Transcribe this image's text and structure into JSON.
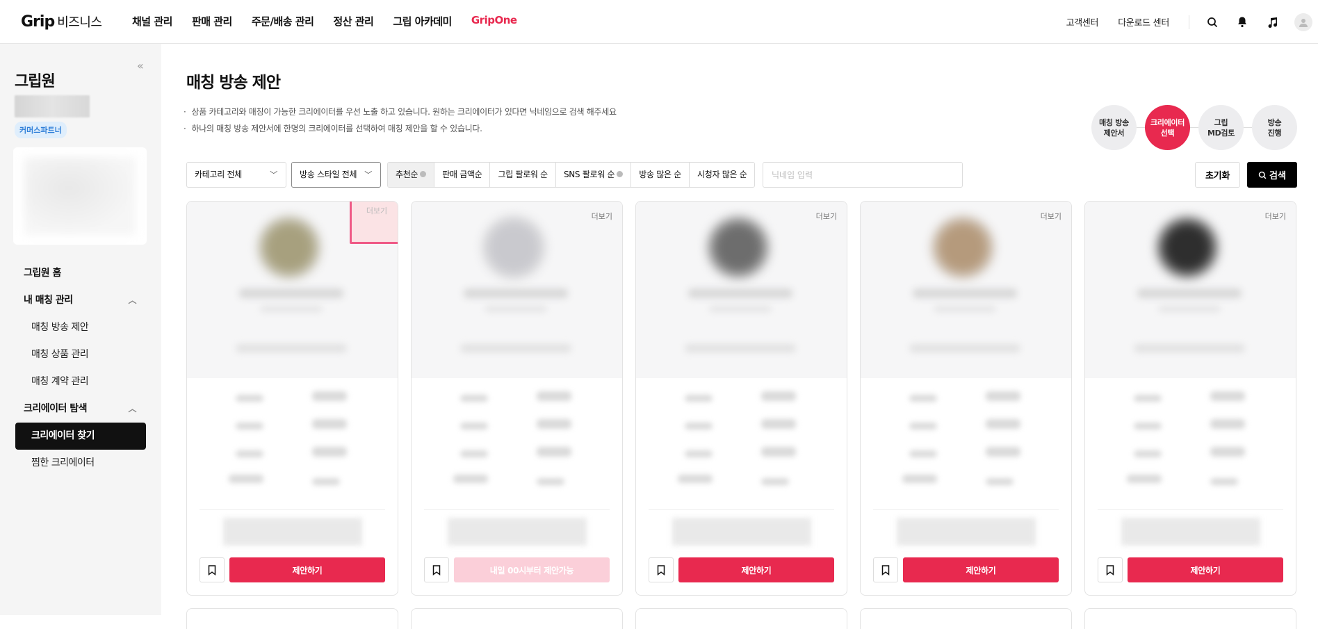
{
  "header": {
    "logo_main": "Grip",
    "logo_sub": "비즈니스",
    "nav": [
      "채널 관리",
      "판매 관리",
      "주문/배송 관리",
      "정산 관리",
      "그립 아카데미",
      "GripOne"
    ],
    "right_links": [
      "고객센터",
      "다운로드 센터"
    ]
  },
  "sidebar": {
    "collapse_label": "«",
    "title": "그립원",
    "badge": "커머스파트너",
    "home": "그립원 홈",
    "group1": "내 매칭 관리",
    "group1_items": [
      "매칭 방송 제안",
      "매칭 상품 관리",
      "매칭 계약 관리"
    ],
    "group2": "크리에이터 탐색",
    "group2_items": [
      "크리에이터 찾기",
      "찜한 크리에이터"
    ]
  },
  "main": {
    "title": "매칭 방송 제안",
    "notes": [
      "상품 카테고리와 매칭이 가능한 크리에이터를 우선 노출 하고 있습니다. 원하는 크리에이터가 있다면 닉네임으로 검색 해주세요",
      "하나의 매칭 방송 제안서에 한명의 크리에이터를 선택하여 매칭 제안을 할 수 있습니다."
    ],
    "steps": [
      "매칭 방송\n제안서",
      "크리에이터\n선택",
      "그립\nMD검토",
      "방송\n진행"
    ],
    "active_step": 1,
    "filters": {
      "category": "카테고리 전체",
      "style": "방송 스타일 전체",
      "sorts": [
        "추천순",
        "판매 금액순",
        "그립 팔로워 순",
        "SNS 팔로워 순",
        "방송 많은 순",
        "시청자 많은 순"
      ],
      "selected_sort": "추천순",
      "search_placeholder": "닉네임 입력",
      "reset": "초기화",
      "search": "검색"
    },
    "cards": [
      {
        "more": "더보기",
        "action": "제안하기",
        "disabled": false,
        "photo": "#a7a07e"
      },
      {
        "more": "더보기",
        "action": "내일 00시부터 제안가능",
        "disabled": true,
        "photo": "#c9c9ce"
      },
      {
        "more": "더보기",
        "action": "제안하기",
        "disabled": false,
        "photo": "#6d6d6d"
      },
      {
        "more": "더보기",
        "action": "제안하기",
        "disabled": false,
        "photo": "#b59a7c"
      },
      {
        "more": "더보기",
        "action": "제안하기",
        "disabled": false,
        "photo": "#2e2e2e"
      }
    ]
  },
  "colors": {
    "accent": "#e8294f",
    "highlight_border": "#ef5a86"
  }
}
